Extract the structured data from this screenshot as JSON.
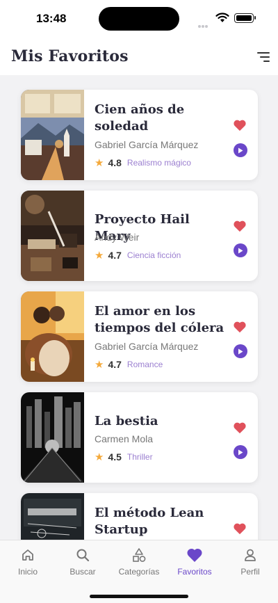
{
  "status_bar": {
    "time": "13:48"
  },
  "header": {
    "title": "Mis Favoritos",
    "filter_icon": "filter-lines-icon"
  },
  "books": [
    {
      "title": "Cien años de soledad",
      "author": "Gabriel García Márquez",
      "rating": "4.8",
      "genre": "Realismo mágico",
      "favorite": true
    },
    {
      "title": "Proyecto Hail Mary",
      "author": "Andy Weir",
      "rating": "4.7",
      "genre": "Ciencia ficción",
      "favorite": true
    },
    {
      "title": "El amor en los tiempos del cólera",
      "author": "Gabriel García Márquez",
      "rating": "4.7",
      "genre": "Romance",
      "favorite": true
    },
    {
      "title": "La bestia",
      "author": "Carmen Mola",
      "rating": "4.5",
      "genre": "Thriller",
      "favorite": true
    },
    {
      "title": "El método Lean Startup",
      "author": "",
      "rating": "",
      "genre": "",
      "favorite": true
    }
  ],
  "tabs": [
    {
      "label": "Inicio",
      "icon": "home-icon",
      "active": false
    },
    {
      "label": "Buscar",
      "icon": "search-icon",
      "active": false
    },
    {
      "label": "Categorías",
      "icon": "categories-icon",
      "active": false
    },
    {
      "label": "Favoritos",
      "icon": "heart-icon",
      "active": true
    },
    {
      "label": "Perfil",
      "icon": "person-icon",
      "active": false
    }
  ],
  "colors": {
    "accent": "#6a47c9",
    "heart": "#e0515b",
    "star": "#f4a93b",
    "genre": "#9b7fd0"
  }
}
